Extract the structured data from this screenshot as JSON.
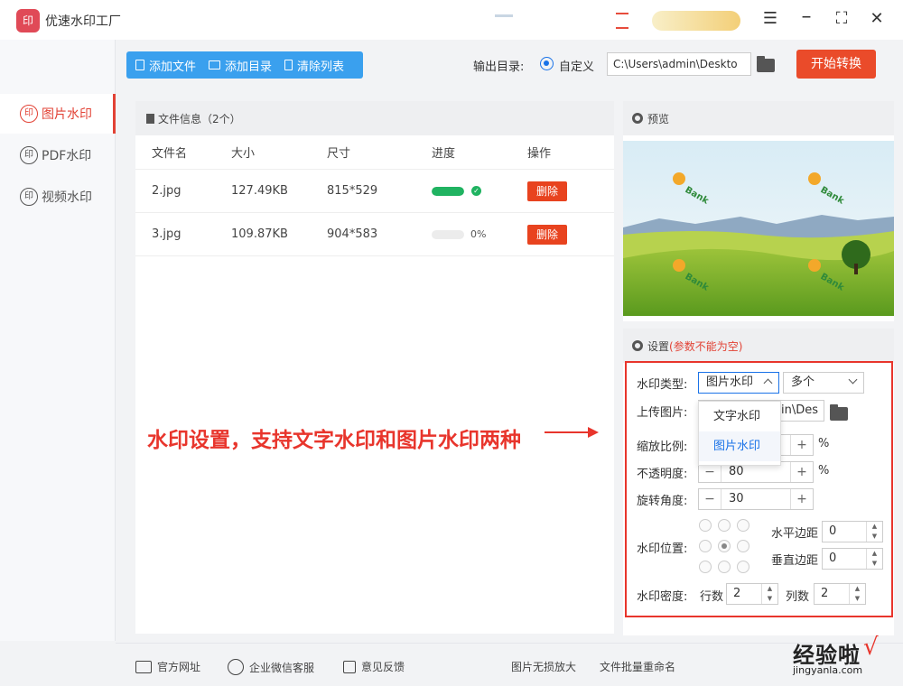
{
  "app": {
    "title": "优速水印工厂",
    "logo_text": "印"
  },
  "nav": {
    "items": [
      {
        "label": "图片水印",
        "icon": "印"
      },
      {
        "label": "PDF水印",
        "icon": "印"
      },
      {
        "label": "视频水印",
        "icon": "印"
      }
    ]
  },
  "toolbar": {
    "add_file": "添加文件",
    "add_dir": "添加目录",
    "clear_list": "清除列表",
    "output_label": "输出目录:",
    "radio_custom": "自定义",
    "output_path": "C:\\Users\\admin\\Deskto",
    "start": "开始转换"
  },
  "file_panel": {
    "title": "文件信息（2个）",
    "columns": [
      "文件名",
      "大小",
      "尺寸",
      "进度",
      "操作"
    ],
    "rows": [
      {
        "name": "2.jpg",
        "size": "127.49KB",
        "dims": "815*529",
        "progress": 1.0,
        "progress_text": "",
        "action": "删除"
      },
      {
        "name": "3.jpg",
        "size": "109.87KB",
        "dims": "904*583",
        "progress": 0.0,
        "progress_text": "0%",
        "action": "删除"
      }
    ]
  },
  "preview": {
    "title": "预览",
    "watermark_text": "Bank"
  },
  "settings": {
    "title": "设置",
    "warn": "(参数不能为空)",
    "type_label": "水印类型:",
    "type_value": "图片水印",
    "count_value": "多个",
    "upload_label": "上传图片:",
    "upload_value": "nin\\Des",
    "scale_label": "缩放比例:",
    "opacity_label": "不透明度:",
    "opacity_value": "80",
    "rotate_label": "旋转角度:",
    "rotate_value": "30",
    "position_label": "水印位置:",
    "h_margin_label": "水平边距",
    "h_margin_value": "0",
    "v_margin_label": "垂直边距",
    "v_margin_value": "0",
    "density_label": "水印密度:",
    "rows_label": "行数",
    "rows_value": "2",
    "cols_label": "列数",
    "cols_value": "2",
    "percent": "%",
    "dropdown_options": [
      "文字水印",
      "图片水印"
    ]
  },
  "annotation": "水印设置，支持文字水印和图片水印两种",
  "footer": {
    "website": "官方网址",
    "wechat": "企业微信客服",
    "feedback": "意见反馈",
    "lossless": "图片无损放大",
    "rename": "文件批量重命名"
  },
  "brand_watermark": {
    "cn": "经验啦",
    "check": "√",
    "url": "jingyanla.com"
  },
  "colors": {
    "accent_red": "#e24235",
    "toolbar_blue": "#3aa0ee",
    "progress_green": "#20b361",
    "start_orange": "#ea4b2a"
  }
}
